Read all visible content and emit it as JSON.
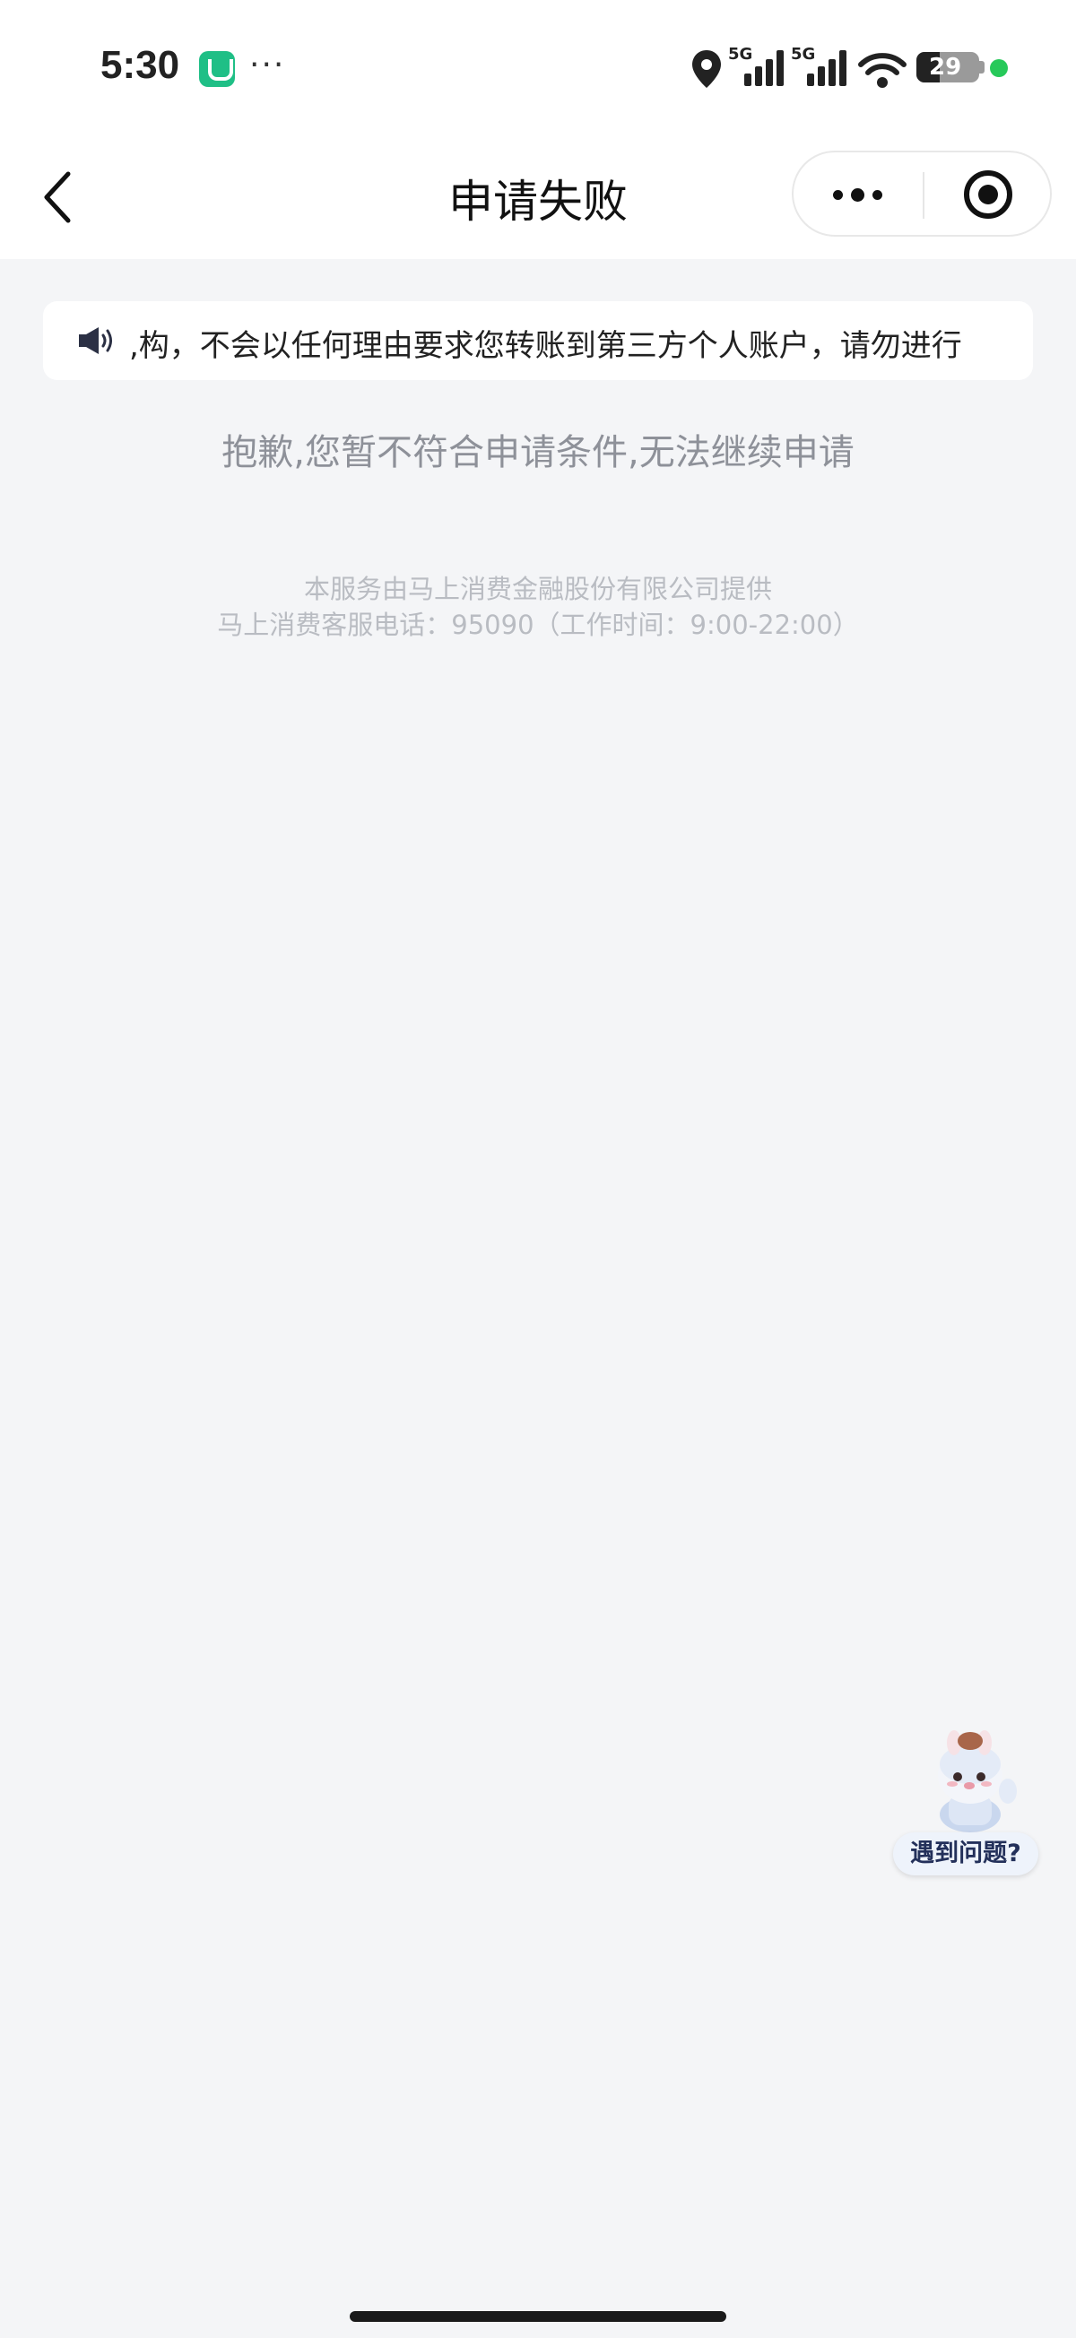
{
  "status_bar": {
    "time": "5:30",
    "more": "···",
    "signal_1": "5G",
    "signal_2": "5G",
    "battery": "29"
  },
  "nav": {
    "title": "申请失败"
  },
  "notice": {
    "text": ",构，不会以任何理由要求您转账到第三方个人账户，请勿进行"
  },
  "main": {
    "message": "抱歉,您暂不符合申请条件,无法继续申请"
  },
  "footer": {
    "provider": "本服务由马上消费金融股份有限公司提供",
    "hotline": "马上消费客服电话：95090（工作时间：9:00-22:00）"
  },
  "help": {
    "label": "遇到问题?"
  },
  "colors": {
    "background": "#f4f5f7",
    "message": "#8e9199",
    "footer": "#b9bcc2",
    "status_green": "#27c95a"
  }
}
